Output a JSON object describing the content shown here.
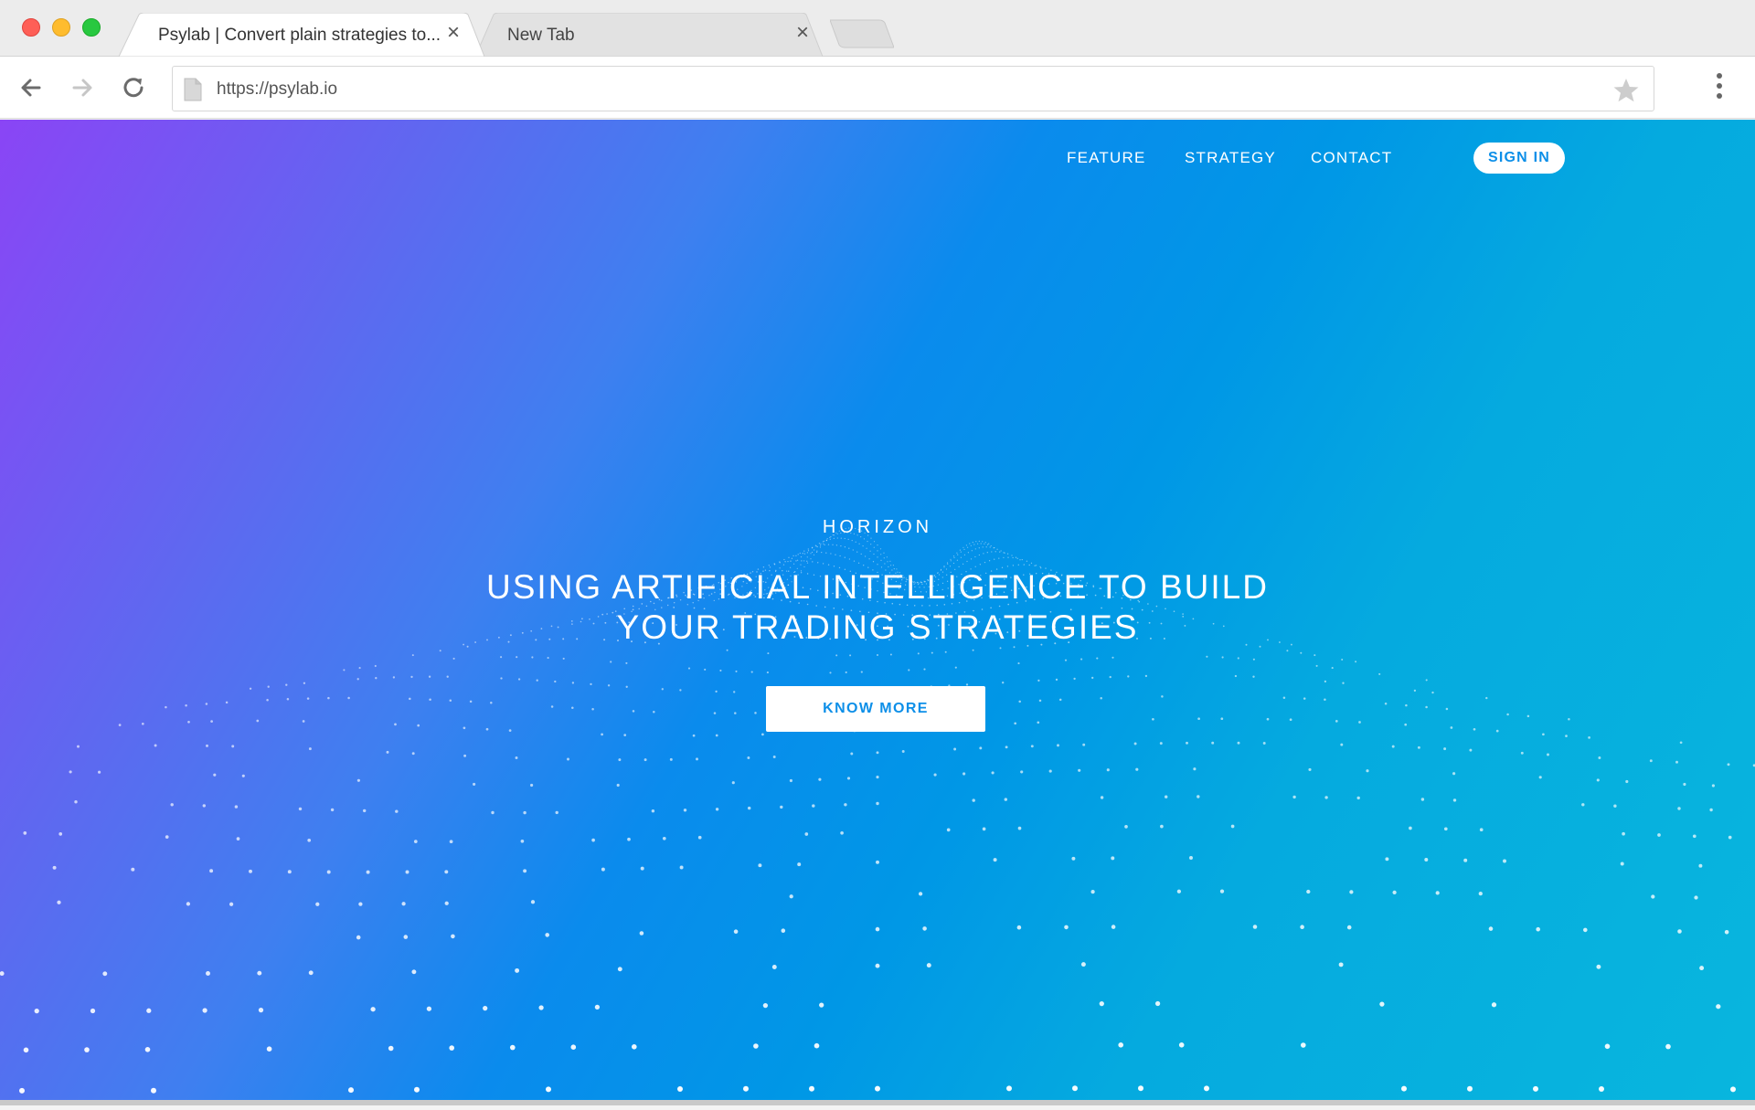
{
  "browser": {
    "tabs": [
      {
        "title": "Psylab | Convert plain strategies to...",
        "active": true
      },
      {
        "title": "New Tab",
        "active": false
      }
    ],
    "address_bar": {
      "url": "https://psylab.io"
    }
  },
  "site": {
    "nav": {
      "items": [
        "FEATURE",
        "STRATEGY",
        "CONTACT"
      ],
      "sign_in": "SIGN IN"
    },
    "hero": {
      "eyebrow": "HORIZON",
      "title_line1": "USING ARTIFICIAL INTELLIGENCE TO BUILD",
      "title_line2": "YOUR TRADING STRATEGIES",
      "cta": "KNOW MORE"
    }
  },
  "colors": {
    "gradient_start": "#8a45f5",
    "gradient_mid": "#0a8bed",
    "gradient_end": "#08b6de",
    "accent_text": "#0d8fe8"
  }
}
